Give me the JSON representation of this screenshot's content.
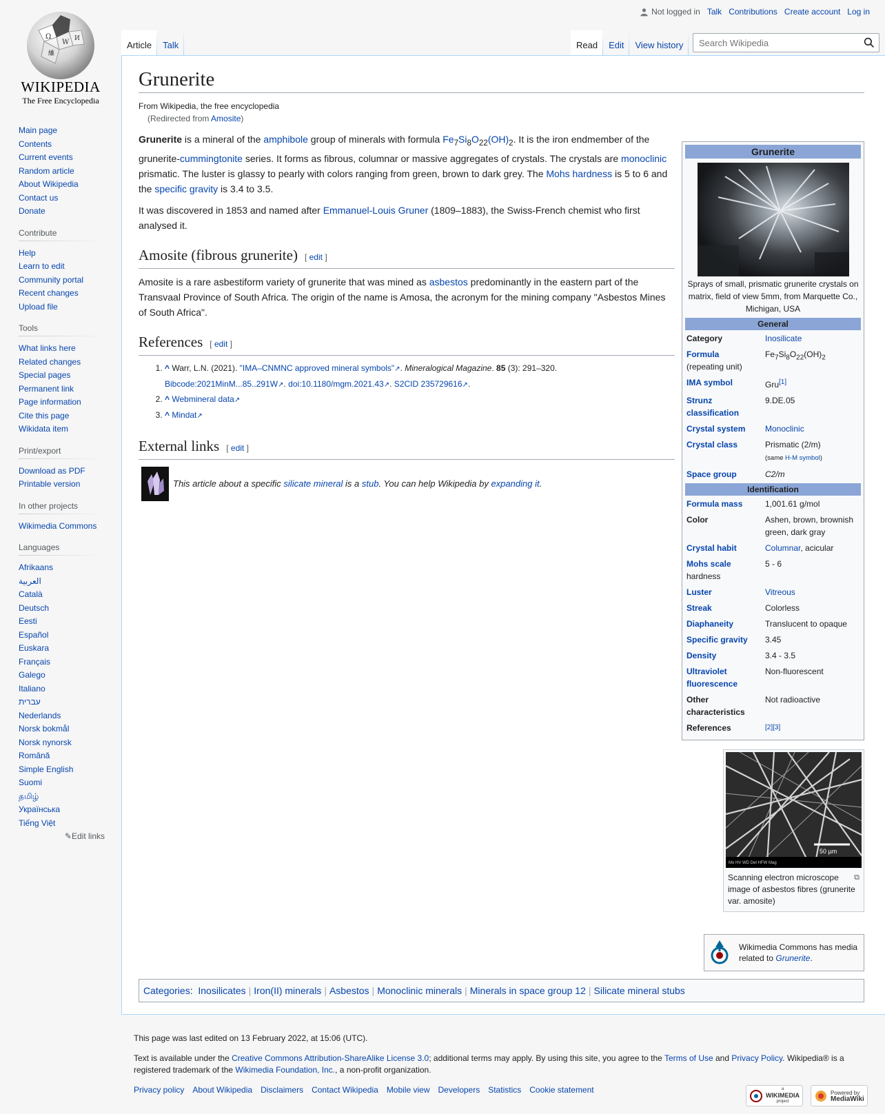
{
  "logo": {
    "wordmark": "WIKIPEDIA",
    "tagline": "The Free Encyclopedia"
  },
  "personal": {
    "not_logged_in": "Not logged in",
    "talk": "Talk",
    "contributions": "Contributions",
    "create_account": "Create account",
    "login": "Log in"
  },
  "nav": {
    "main": [
      "Main page",
      "Contents",
      "Current events",
      "Random article",
      "About Wikipedia",
      "Contact us",
      "Donate"
    ],
    "contribute": {
      "heading": "Contribute",
      "items": [
        "Help",
        "Learn to edit",
        "Community portal",
        "Recent changes",
        "Upload file"
      ]
    },
    "tools": {
      "heading": "Tools",
      "items": [
        "What links here",
        "Related changes",
        "Special pages",
        "Permanent link",
        "Page information",
        "Cite this page",
        "Wikidata item"
      ]
    },
    "print": {
      "heading": "Print/export",
      "items": [
        "Download as PDF",
        "Printable version"
      ]
    },
    "projects": {
      "heading": "In other projects",
      "items": [
        "Wikimedia Commons"
      ]
    },
    "languages": {
      "heading": "Languages",
      "items": [
        "Afrikaans",
        "العربية",
        "Català",
        "Deutsch",
        "Eesti",
        "Español",
        "Euskara",
        "Français",
        "Galego",
        "Italiano",
        "עברית",
        "Nederlands",
        "Norsk bokmål",
        "Norsk nynorsk",
        "Română",
        "Simple English",
        "Suomi",
        "தமிழ்",
        "Українська",
        "Tiếng Việt"
      ],
      "edit_links": "Edit links"
    }
  },
  "tabs": {
    "article": "Article",
    "talk": "Talk",
    "read": "Read",
    "edit": "Edit",
    "history": "View history"
  },
  "search": {
    "placeholder": "Search Wikipedia"
  },
  "article": {
    "title": "Grunerite",
    "site_sub": "From Wikipedia, the free encyclopedia",
    "redirect_pre": "(Redirected from ",
    "redirect_link": "Amosite",
    "redirect_post": ")",
    "intro": {
      "bold": "Grunerite",
      "t1": " is a mineral of the ",
      "l_amphibole": "amphibole",
      "t2": " group of minerals with formula ",
      "f_fe": "Fe",
      "f_7": "7",
      "f_si": "Si",
      "f_8": "8",
      "f_o": "O",
      "f_22": "22",
      "f_oh": "(OH)",
      "f_2": "2",
      "t3": ". It is the iron endmember of the grunerite-",
      "l_cumm": "cummingtonite",
      "t4": " series. It forms as fibrous, columnar or massive aggregates of crystals. The crystals are ",
      "l_mono": "monoclinic",
      "t5": " prismatic. The luster is glassy to pearly with colors ranging from green, brown to dark grey. The ",
      "l_mohs": "Mohs hardness",
      "t6": " is 5 to 6 and the ",
      "l_sg": "specific gravity",
      "t7": " is 3.4 to 3.5."
    },
    "p2": {
      "t1": "It was discovered in 1853 and named after ",
      "l_gruner": "Emmanuel-Louis Gruner",
      "t2": " (1809–1883), the Swiss-French chemist who first analysed it."
    },
    "sec_amosite": "Amosite (fibrous grunerite)",
    "amosite": {
      "t1": "Amosite is a rare asbestiform variety of grunerite that was mined as ",
      "l_asb": "asbestos",
      "t2": " predominantly in the eastern part of the Transvaal Province of South Africa. The origin of the name is Amosa, the acronym for the mining company \"Asbestos Mines of South Africa\"."
    },
    "sec_refs": "References",
    "refs": {
      "r1_a": "Warr, L.N. (2021). ",
      "r1_title": "\"IMA–CNMNC approved mineral symbols\"",
      "r1_b": ". ",
      "r1_journal": "Mineralogical Magazine",
      "r1_c": ". ",
      "r1_vol": "85",
      "r1_d": " (3): 291–320. ",
      "r1_bib_l": "Bibcode",
      "r1_bib_v": ":2021MinM...85..291W",
      "r1_doi_l": "doi",
      "r1_doi_v": ":10.1180/mgm.2021.43",
      "r1_s2_l": "S2CID",
      "r1_s2_v": "235729616",
      "r2": "Webmineral data",
      "r3": "Mindat"
    },
    "sec_ext": "External links",
    "edit_label": "edit",
    "stub": {
      "t1": "This article about a specific ",
      "l_sil": "silicate mineral",
      "t2": " is a ",
      "l_stub": "stub",
      "t3": ". You can help Wikipedia by ",
      "l_exp": "expanding it",
      "t4": "."
    }
  },
  "infobox": {
    "title": "Grunerite",
    "caption": "Sprays of small, prismatic grunerite crystals on matrix, field of view 5mm, from Marquette Co., Michigan, USA",
    "general": "General",
    "identification": "Identification",
    "rows_general": [
      {
        "k": "Category",
        "v": "Inosilicate"
      },
      {
        "k": "Formula",
        "k2": "(repeating unit)"
      },
      {
        "k": "IMA symbol",
        "v": "Gru",
        "sup": "[1]"
      },
      {
        "k": "Strunz classification",
        "v": "9.DE.05"
      },
      {
        "k": "Crystal system",
        "v": "Monoclinic"
      },
      {
        "k": "Crystal class",
        "v": "Prismatic (2/m)",
        "v2a": "(same ",
        "v2l": "H-M symbol",
        "v2b": ")"
      },
      {
        "k": "Space group",
        "v": "C2/m"
      }
    ],
    "formula": {
      "fe": "Fe",
      "n7": "7",
      "si": "Si",
      "n8": "8",
      "o": "O",
      "n22": "22",
      "oh": "(OH)",
      "n2": "2"
    },
    "rows_ident": [
      {
        "k": "Formula mass",
        "v": "1,001.61 g/mol"
      },
      {
        "k": "Color",
        "v": "Ashen, brown, brownish green, dark gray"
      },
      {
        "k": "Crystal habit",
        "v": "Columnar",
        "v_tail": ", acicular"
      },
      {
        "k": "Mohs scale",
        "k2": "hardness",
        "v": "5 - 6"
      },
      {
        "k": "Luster",
        "v": "Vitreous"
      },
      {
        "k": "Streak",
        "v": "Colorless"
      },
      {
        "k": "Diaphaneity",
        "v": "Translucent to opaque"
      },
      {
        "k": "Specific gravity",
        "v": "3.45"
      },
      {
        "k": "Density",
        "v": "3.4 - 3.5"
      },
      {
        "k": "Ultraviolet fluorescence",
        "v": "Non-fluorescent"
      },
      {
        "k": "Other characteristics",
        "v": "Not radioactive"
      },
      {
        "k": "References",
        "v": "[2][3]"
      }
    ]
  },
  "sem": {
    "scale": "50 µm",
    "strip": "Mo HV WD Det HFW Mag",
    "caption": "Scanning electron microscope image of asbestos fibres (grunerite var. amosite)"
  },
  "commons": {
    "t1": "Wikimedia Commons has media related to ",
    "link": "Grunerite",
    "t2": "."
  },
  "categories": {
    "label": "Categories",
    "items": [
      "Inosilicates",
      "Iron(II) minerals",
      "Asbestos",
      "Monoclinic minerals",
      "Minerals in space group 12",
      "Silicate mineral stubs"
    ]
  },
  "footer": {
    "edited": "This page was last edited on 13 February 2022, at 15:06 (UTC).",
    "lic_1": "Text is available under the ",
    "lic_link": "Creative Commons Attribution-ShareAlike License 3.0",
    "lic_2": "; additional terms may apply. By using this site, you agree to the ",
    "lic_terms": "Terms of Use",
    "lic_3": " and ",
    "lic_privacy": "Privacy Policy",
    "lic_4": ". Wikipedia® is a registered trademark of the ",
    "lic_wmf": "Wikimedia Foundation, Inc.",
    "lic_5": ", a non-profit organization.",
    "links": [
      "Privacy policy",
      "About Wikipedia",
      "Disclaimers",
      "Contact Wikipedia",
      "Mobile view",
      "Developers",
      "Statistics",
      "Cookie statement"
    ],
    "badge_wm_a": "a",
    "badge_wm": "WIKIMEDIA",
    "badge_wm_b": "project",
    "badge_mw_a": "Powered by",
    "badge_mw": "MediaWiki"
  },
  "colors": {
    "link": "#0645ad",
    "infobox_header": "#8ba6d6",
    "tab_border": "#a7d7f9"
  }
}
